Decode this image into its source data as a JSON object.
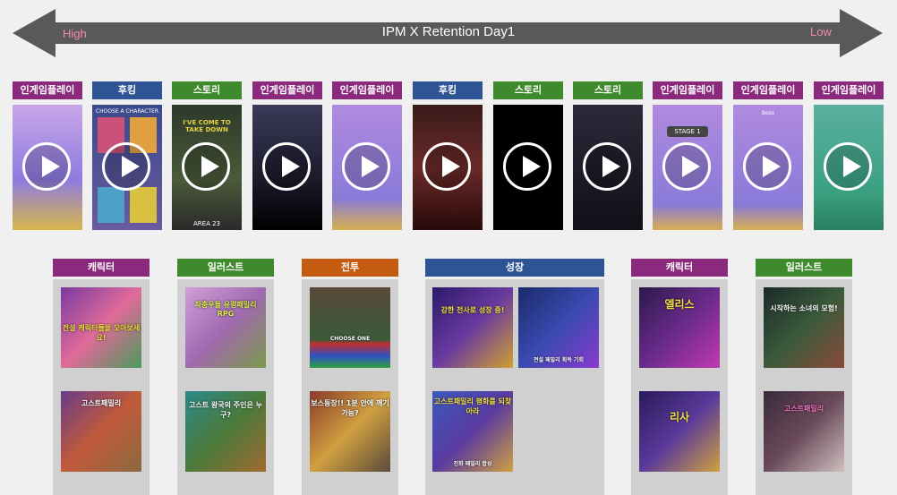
{
  "header": {
    "title": "IPM X Retention Day1",
    "high": "High",
    "low": "Low"
  },
  "colors": {
    "ingame": "#8b2a7c",
    "hook": "#2f5496",
    "story": "#3f8a2c",
    "character": "#8b2a7c",
    "illust": "#3f8a2c",
    "battle": "#c55a11",
    "growth": "#2f5496"
  },
  "videos": [
    {
      "label": "인게임플레이"
    },
    {
      "label": "후킹",
      "art": "CHOOSE A CHARACTER"
    },
    {
      "label": "스토리",
      "art": "I'VE COME TO TAKE DOWN",
      "art2": "AREA 23"
    },
    {
      "label": "인게임플레이"
    },
    {
      "label": "인게임플레이"
    },
    {
      "label": "후킹"
    },
    {
      "label": "스토리"
    },
    {
      "label": "스토리"
    },
    {
      "label": "인게임플레이",
      "art": "STAGE 1"
    },
    {
      "label": "인게임플레이",
      "art": "Boss"
    },
    {
      "label": "인게임플레이"
    }
  ],
  "groups": [
    {
      "label": "캐릭터",
      "items": [
        {
          "caption": "전설 캐릭터들을 모아보세요!"
        },
        {
          "caption": "고스트패밀리"
        }
      ]
    },
    {
      "label": "일러스트",
      "items": [
        {
          "caption": "좌충우돌 유령패밀리 RPG"
        },
        {
          "caption": "고스트 왕국의 주인은 누구?"
        }
      ]
    },
    {
      "label": "전투",
      "items": [
        {
          "caption": "CHOOSE ONE"
        },
        {
          "caption": "보스등장!! 1분 안에 깨기 가능?"
        }
      ]
    },
    {
      "label": "성장",
      "items": [
        {
          "caption": "강한 전사로 성장 중!"
        },
        {
          "caption": "전설 패밀리 획득 기회"
        },
        {
          "caption": "고스트패밀리 평화를 되찾아라"
        },
        {
          "caption": "진화 패밀리 합성"
        }
      ]
    },
    {
      "label": "캐릭터",
      "items": [
        {
          "caption": "엘리스"
        },
        {
          "caption": "리사"
        }
      ]
    },
    {
      "label": "일러스트",
      "items": [
        {
          "caption": "시작하는 소녀의 모험!"
        },
        {
          "caption": "고스트패밀리"
        }
      ]
    }
  ]
}
